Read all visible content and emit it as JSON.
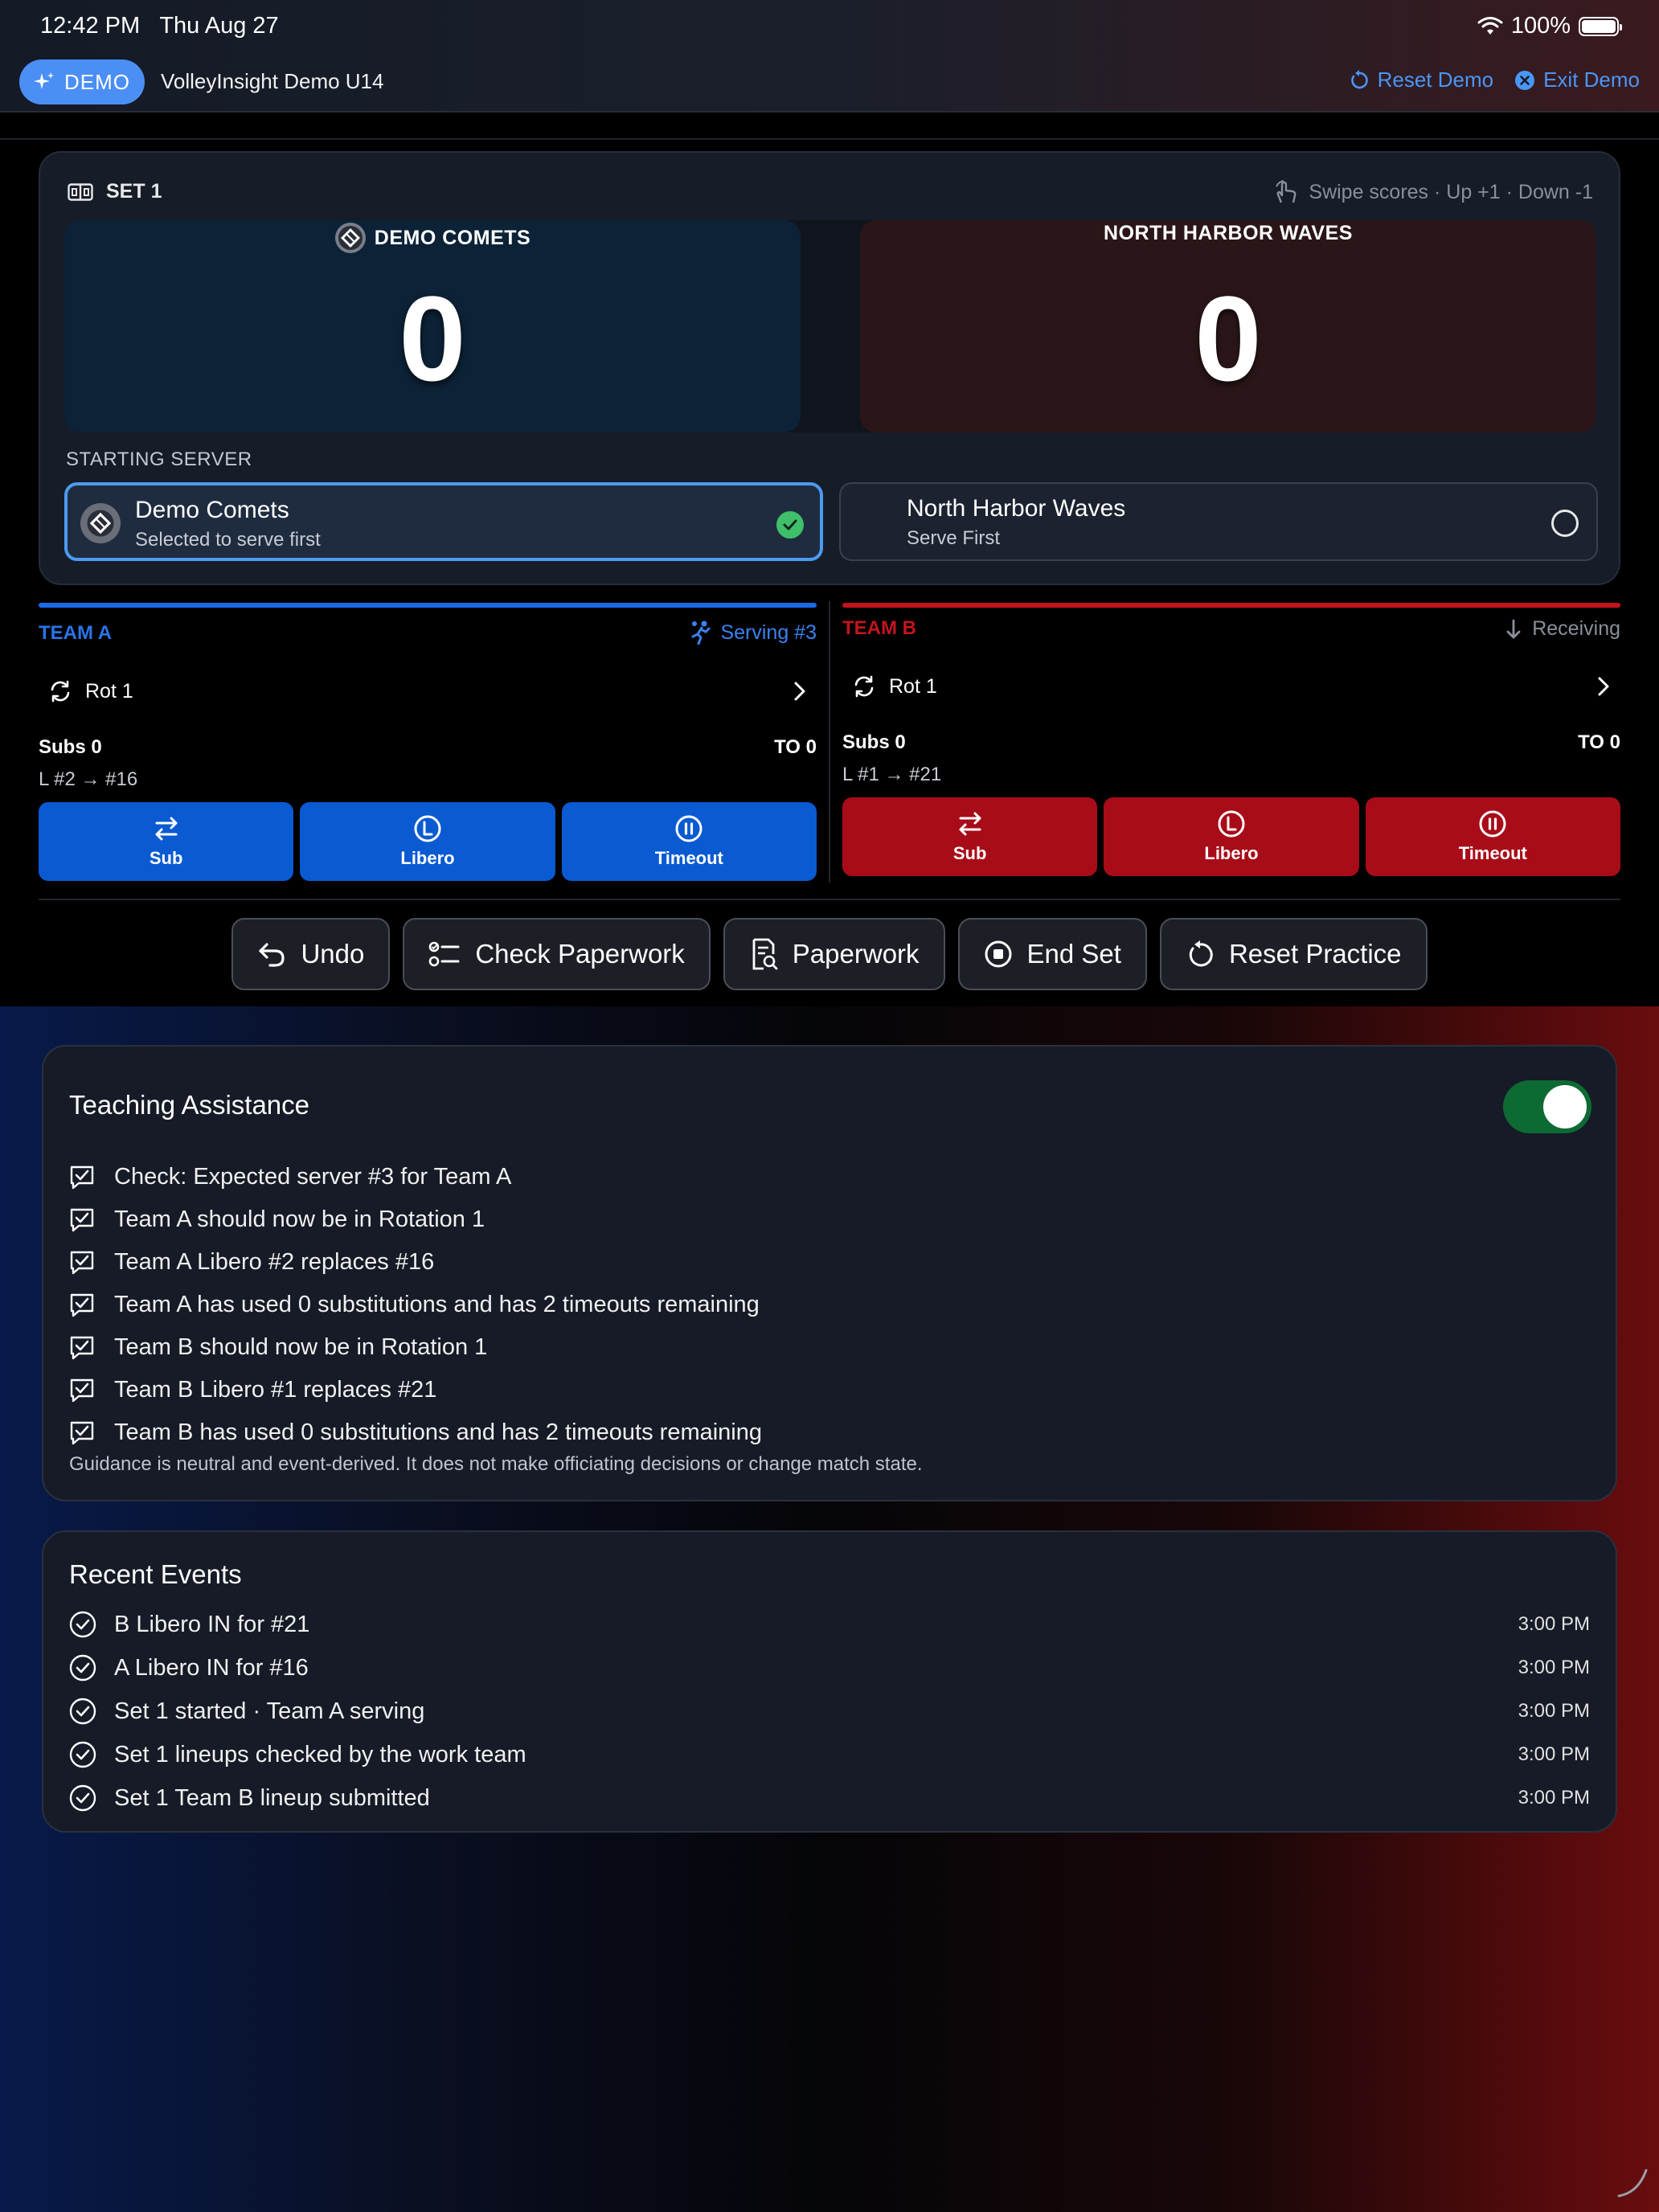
{
  "status": {
    "time": "12:42 PM",
    "date": "Thu Aug 27",
    "battery": "100%"
  },
  "header": {
    "demo_label": "DEMO",
    "title": "VolleyInsight Demo U14",
    "reset_label": "Reset Demo",
    "exit_label": "Exit Demo"
  },
  "scoreboard": {
    "set_label": "SET 1",
    "swipe_hint": "Swipe scores · Up +1 · Down -1",
    "team_a": {
      "name": "DEMO COMETS",
      "score": "0"
    },
    "team_b": {
      "name": "NORTH HARBOR WAVES",
      "score": "0"
    },
    "starting_server_label": "STARTING SERVER",
    "server_a": {
      "name": "Demo Comets",
      "sub": "Selected to serve first",
      "selected": true
    },
    "server_b": {
      "name": "North Harbor Waves",
      "sub": "Serve First",
      "selected": false
    }
  },
  "team_a": {
    "tag": "TEAM A",
    "state": "Serving #3",
    "rotation": "Rot 1",
    "subs": "Subs 0",
    "timeouts": "TO 0",
    "libero": "L #2 → #16",
    "actions": {
      "sub": "Sub",
      "libero": "Libero",
      "timeout": "Timeout"
    }
  },
  "team_b": {
    "tag": "TEAM B",
    "state": "Receiving",
    "rotation": "Rot 1",
    "subs": "Subs 0",
    "timeouts": "TO 0",
    "libero": "L #1 → #21",
    "actions": {
      "sub": "Sub",
      "libero": "Libero",
      "timeout": "Timeout"
    }
  },
  "toolbar": {
    "undo": "Undo",
    "check_paperwork": "Check Paperwork",
    "paperwork": "Paperwork",
    "end_set": "End Set",
    "reset_practice": "Reset Practice"
  },
  "teaching": {
    "title": "Teaching Assistance",
    "enabled": true,
    "items": [
      "Check: Expected server #3 for Team A",
      "Team A should now be in Rotation 1",
      "Team A Libero #2 replaces #16",
      "Team A has used 0 substitutions and has 2 timeouts remaining",
      "Team B should now be in Rotation 1",
      "Team B Libero #1 replaces #21",
      "Team B has used 0 substitutions and has 2 timeouts remaining"
    ],
    "guidance": "Guidance is neutral and event-derived. It does not make officiating decisions or change match state."
  },
  "recent": {
    "title": "Recent Events",
    "items": [
      {
        "text": "B Libero IN for #21",
        "time": "3:00 PM"
      },
      {
        "text": "A Libero IN for #16",
        "time": "3:00 PM"
      },
      {
        "text": "Set 1 started · Team A serving",
        "time": "3:00 PM"
      },
      {
        "text": "Set 1 lineups checked by the work team",
        "time": "3:00 PM"
      },
      {
        "text": "Set 1 Team B lineup submitted",
        "time": "3:00 PM"
      }
    ]
  },
  "colors": {
    "team_a": "#0a5ad2",
    "team_b": "#a80c18",
    "accent": "#4a96f5",
    "toggle_on": "#0d6a32"
  }
}
